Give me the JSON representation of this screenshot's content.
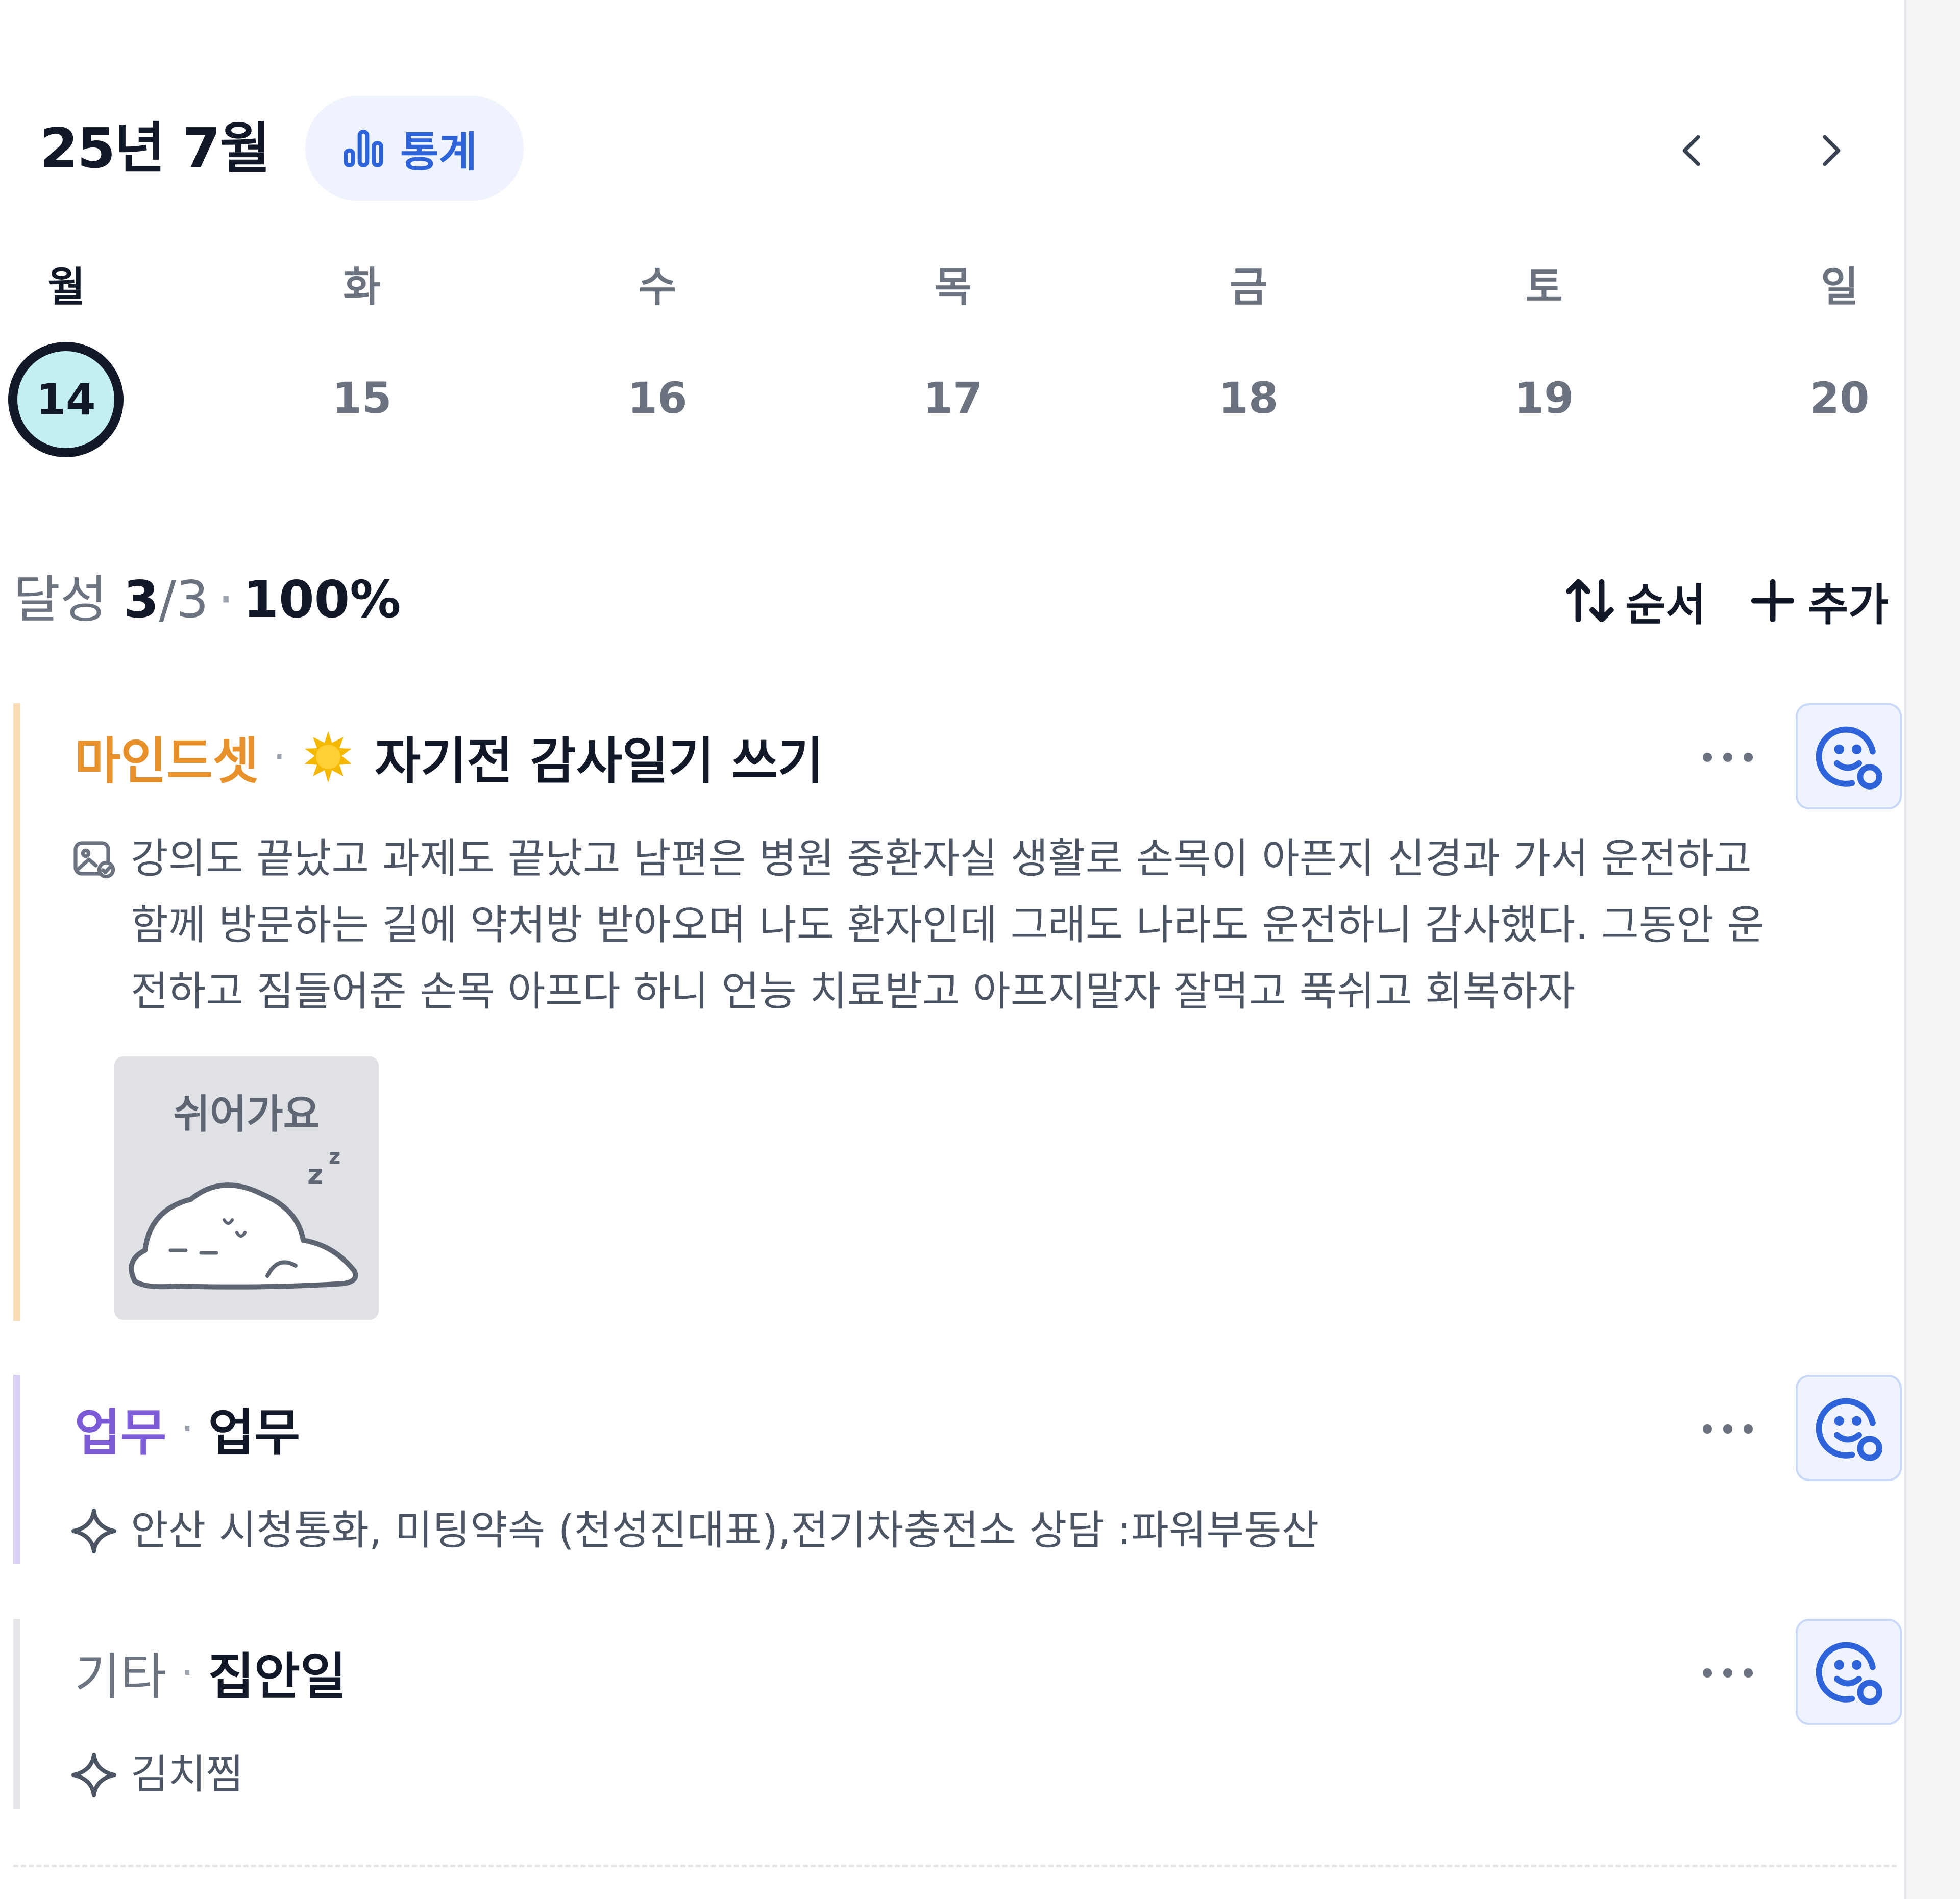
{
  "header": {
    "month_title": "25년 7월",
    "stats_label": "통계",
    "prev_icon": "chevron-left-icon",
    "next_icon": "chevron-right-icon"
  },
  "week": {
    "days": [
      {
        "weekday": "월",
        "date": "14",
        "selected": true
      },
      {
        "weekday": "화",
        "date": "15"
      },
      {
        "weekday": "수",
        "date": "16"
      },
      {
        "weekday": "목",
        "date": "17"
      },
      {
        "weekday": "금",
        "date": "18"
      },
      {
        "weekday": "토",
        "date": "19"
      },
      {
        "weekday": "일",
        "date": "20"
      }
    ]
  },
  "summary": {
    "label": "달성",
    "done": "3",
    "total_sep": "/3",
    "dot": "·",
    "percent": "100%",
    "sort_label": "순서",
    "add_label": "추가"
  },
  "tasks": [
    {
      "category": "마인드셋",
      "category_color": "#e8912a",
      "bar_color": "#f8dcb5",
      "sep": "·",
      "icon": "sun-emoji-icon",
      "title": "자기전 감사일기 쓰기",
      "note_icon": "image-note-icon",
      "note_lines": [
        "강의도 끝났고 과제도 끝났고 남편은 병원 중환자실 생활로 손목이 아픈지 신경과 가서 운전하고",
        "함께 방문하는 길에 약처방 받아오며 나도 환자인데 그래도 나라도 운전하니 감사했다. 그동안 운",
        "전하고 짐들어준 손목 아프다 하니 언능 치료받고 아프지말자 잘먹고 푹쉬고 회복하자"
      ],
      "sticker_text": "쉬어가요"
    },
    {
      "category": "업무",
      "category_color": "#7b5bd6",
      "bar_color": "#d9d0f4",
      "sep": "·",
      "title": "업무",
      "note_icon": "sparkle-icon",
      "note_lines": [
        "안산 시청통화, 미팅약속 (천성진대표),전기차충전소 상담 :파워부동산"
      ]
    },
    {
      "category": "기타",
      "category_color": "#6b7280",
      "bar_color": "#e5e7eb",
      "sep": "·",
      "title": "집안일",
      "note_icon": "sparkle-icon",
      "note_lines": [
        "김치찜"
      ]
    }
  ]
}
